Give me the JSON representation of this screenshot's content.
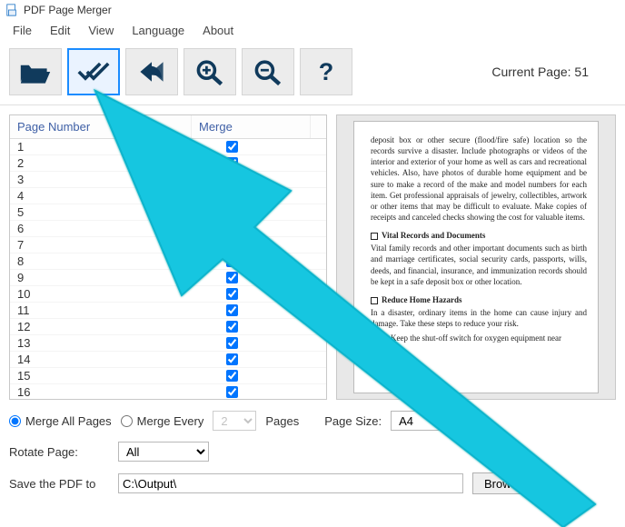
{
  "title": "PDF Page Merger",
  "menu": {
    "file": "File",
    "edit": "Edit",
    "view": "View",
    "language": "Language",
    "about": "About"
  },
  "toolbar": {
    "current_page_label": "Current Page: 51"
  },
  "list": {
    "header_number": "Page Number",
    "header_merge": "Merge",
    "rows": [
      "1",
      "2",
      "3",
      "4",
      "5",
      "6",
      "7",
      "8",
      "9",
      "10",
      "11",
      "12",
      "13",
      "14",
      "15",
      "16"
    ]
  },
  "preview": {
    "p1": "deposit box or other secure (flood/fire safe) location so the records survive a disaster. Include photographs or videos of the interior and exterior of your home as well as cars and recreational vehicles. Also, have photos of durable home equipment and be sure to make a record of the make and model numbers for each item. Get professional appraisals of jewelry, collectibles, artwork or other items that may be difficult to evaluate. Make copies of receipts and canceled checks showing the cost for valuable items.",
    "h2": "Vital Records and Documents",
    "p2": "Vital family records and other important documents such as birth and marriage certificates, social security cards, passports, wills, deeds, and financial, insurance, and immunization records should be kept in a safe deposit box or other location.",
    "h3": "Reduce Home Hazards",
    "p3": "In a disaster, ordinary items in the home can cause injury and damage. Take these steps to reduce your risk.",
    "b1": "Keep the shut-off switch for oxygen equipment near"
  },
  "options": {
    "merge_all": "Merge All Pages",
    "merge_every": "Merge Every",
    "merge_every_value": "2",
    "pages_label": "Pages",
    "page_size_label": "Page Size:",
    "page_size_value": "A4",
    "rotate_label": "Rotate Page:",
    "rotate_value": "All",
    "save_label": "Save the PDF to",
    "save_path": "C:\\Output\\",
    "browse": "Browse"
  }
}
